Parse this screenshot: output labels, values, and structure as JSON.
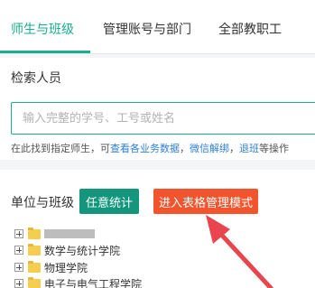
{
  "tabs": [
    {
      "label": "师生与班级",
      "active": true
    },
    {
      "label": "管理账号与部门",
      "active": false
    },
    {
      "label": "全部教职工",
      "active": false
    }
  ],
  "search": {
    "label": "检索人员",
    "placeholder": "输入完整的学号、工号或姓名",
    "hint": {
      "prefix": "在此找到指定师生，可",
      "link1": "查看各业务数据",
      "sep1": "，",
      "link2": "微信解绑",
      "sep2": "，",
      "link3": "退班",
      "suffix": "等操作"
    }
  },
  "unit": {
    "label": "单位与班级",
    "stats_button": "任意统计",
    "table_mode_button": "进入表格管理模式"
  },
  "tree": [
    {
      "label": "",
      "redacted": true
    },
    {
      "label": "数学与统计学院"
    },
    {
      "label": "物理学院"
    },
    {
      "label": "电子与电气工程学院"
    }
  ],
  "colors": {
    "accent": "#1aad8f",
    "stats_button": "#13967c",
    "table_mode_button": "#f2542d",
    "link": "#2f7fd8",
    "annotation_arrow": "#e8454f"
  },
  "icons": [
    "plus-square-icon",
    "folder-icon",
    "annotation-arrow"
  ]
}
